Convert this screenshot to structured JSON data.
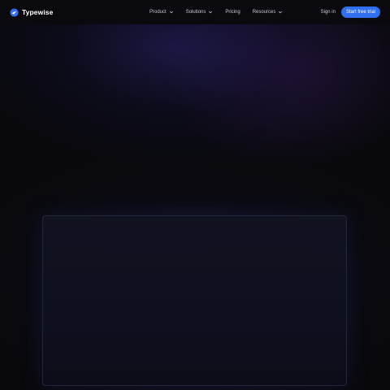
{
  "brand": {
    "name": "Typewise",
    "logo_icon": "typewise-logo-icon",
    "color": "#2f6ff0"
  },
  "nav": {
    "items": [
      {
        "label": "Product",
        "has_dropdown": true
      },
      {
        "label": "Solutions",
        "has_dropdown": true
      },
      {
        "label": "Pricing",
        "has_dropdown": false
      },
      {
        "label": "Resources",
        "has_dropdown": true
      }
    ],
    "chevron_icon": "chevron-down-icon"
  },
  "actions": {
    "sign_in_label": "Sign in",
    "cta_label": "Start free trial",
    "cta_color": "#2f6ff0"
  },
  "colors": {
    "background": "#09090d",
    "navbar": "#0a0a0e",
    "nav_text": "#c7c8d2",
    "panel_border": "#23263a"
  }
}
